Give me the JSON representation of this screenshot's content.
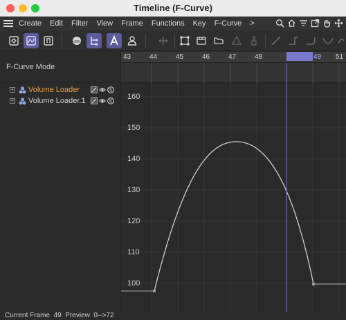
{
  "window": {
    "title": "Timeline (F-Curve)"
  },
  "menu": {
    "items": [
      "Create",
      "Edit",
      "Filter",
      "View",
      "Frame",
      "Functions",
      "Key",
      "F-Curve",
      ">"
    ]
  },
  "left_panel": {
    "mode_label": "F-Curve Mode",
    "objects": [
      {
        "name": "Volume Loader",
        "selected": true
      },
      {
        "name": "Volume Loader.1",
        "selected": false
      }
    ]
  },
  "ruler": {
    "frames": [
      "43",
      "44",
      "45",
      "46",
      "47",
      "48",
      "49",
      "51"
    ],
    "current_frame": "49"
  },
  "graph": {
    "y_labels": [
      "160",
      "150",
      "140",
      "130",
      "120",
      "110",
      "100"
    ]
  },
  "status": {
    "text": "Current Frame  49  Preview  0-->72"
  },
  "colors": {
    "accent": "#5b5b9a",
    "playhead": "#7a7acc",
    "selected_object": "#e8a040",
    "curve": "#d0d0d0"
  }
}
